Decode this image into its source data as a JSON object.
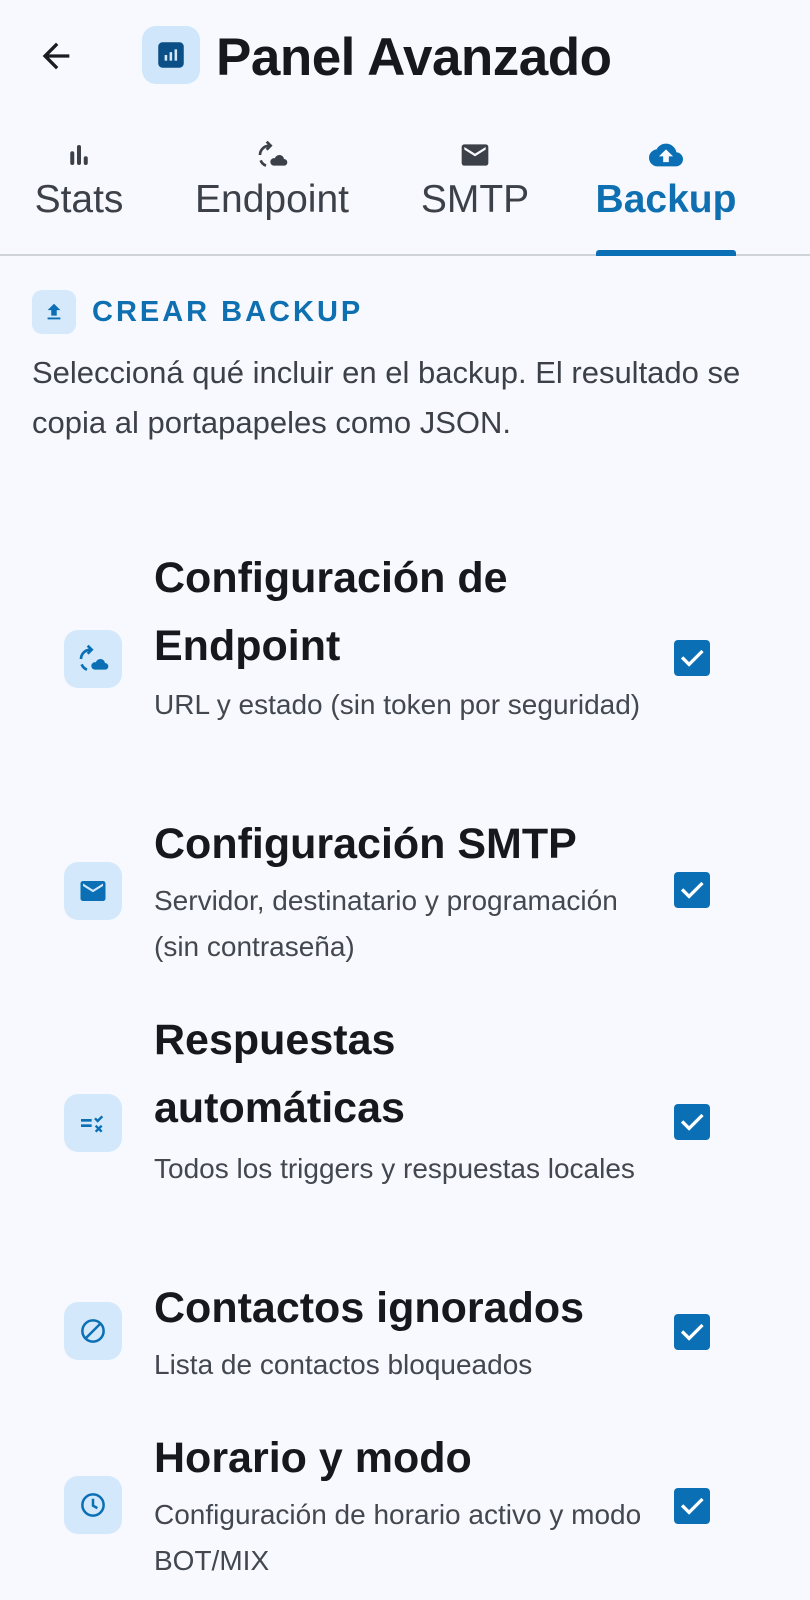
{
  "appbar": {
    "title": "Panel Avanzado",
    "back_icon": "arrow-left-icon",
    "title_icon": "dashboard-icon"
  },
  "tabs": [
    {
      "label": "Stats",
      "icon": "bar-chart-icon",
      "active": false
    },
    {
      "label": "Endpoint",
      "icon": "sync-cloud-icon",
      "active": false
    },
    {
      "label": "SMTP",
      "icon": "mail-icon",
      "active": false
    },
    {
      "label": "Backup",
      "icon": "cloud-upload-icon",
      "active": true
    }
  ],
  "section": {
    "title": "CREAR BACKUP",
    "icon": "upload-icon",
    "description": "Seleccioná qué incluir en el backup. El resultado se copia al portapapeles como JSON."
  },
  "options": [
    {
      "title": "Configuración de Endpoint",
      "subtitle": "URL y estado (sin token por seguridad)",
      "icon": "sync-cloud-icon",
      "checked": true
    },
    {
      "title": "Configuración SMTP",
      "subtitle": "Servidor, destinatario y programación (sin contraseña)",
      "icon": "mail-icon",
      "checked": true
    },
    {
      "title": "Respuestas automáticas",
      "subtitle": "Todos los triggers y respuestas locales",
      "icon": "rule-icon",
      "checked": true
    },
    {
      "title": "Contactos ignorados",
      "subtitle": "Lista de contactos bloqueados",
      "icon": "block-icon",
      "checked": true
    },
    {
      "title": "Horario y modo",
      "subtitle": "Configuración de horario activo y modo BOT/MIX",
      "icon": "clock-icon",
      "checked": true
    }
  ],
  "colors": {
    "accent": "#0a6fb4",
    "icon_bg": "#d3e8fb",
    "background": "#f7f9fe"
  }
}
